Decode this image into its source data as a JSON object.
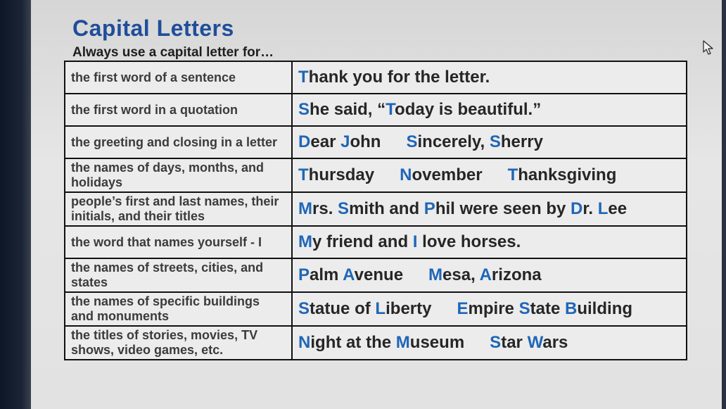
{
  "title": "Capital Letters",
  "subtitle": "Always use a capital letter for…",
  "rows": [
    {
      "rule": "the first word of a sentence",
      "examples": [
        "Thank you for the letter."
      ]
    },
    {
      "rule": "the first word in a quotation",
      "examples": [
        "She said, “Today is beautiful.”"
      ]
    },
    {
      "rule": "the greeting and closing in a letter",
      "examples": [
        "Dear John",
        "Sincerely, Sherry"
      ]
    },
    {
      "rule": "the names of days, months, and holidays",
      "examples": [
        "Thursday",
        "November",
        "Thanksgiving"
      ]
    },
    {
      "rule": "people’s first and last names, their initials, and their titles",
      "examples": [
        "Mrs. Smith and Phil were seen by Dr. Lee"
      ]
    },
    {
      "rule": "the word that names yourself - I",
      "examples": [
        "My friend and I love horses."
      ]
    },
    {
      "rule": "the names of streets, cities, and states",
      "examples": [
        "Palm Avenue",
        "Mesa, Arizona"
      ]
    },
    {
      "rule": "the names of specific buildings and monuments",
      "examples": [
        "Statue of Liberty",
        "Empire State Building"
      ]
    },
    {
      "rule": "the titles of stories, movies, TV shows, video games, etc.",
      "examples": [
        "Night at the Museum",
        "Star Wars"
      ]
    }
  ],
  "colors": {
    "title": "#1f4e9a",
    "highlight": "#1f66b7",
    "text": "#262626"
  },
  "icons": {
    "cursor": "mouse-pointer-icon"
  }
}
